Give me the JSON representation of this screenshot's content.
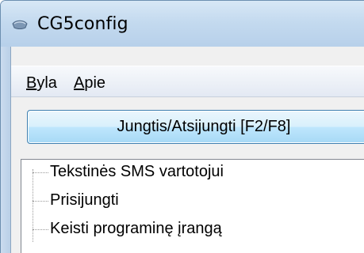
{
  "window": {
    "title": "CG5config"
  },
  "menu": {
    "items": [
      {
        "accel": "B",
        "rest": "yla"
      },
      {
        "accel": "A",
        "rest": "pie"
      }
    ]
  },
  "connect_button": {
    "label": "Jungtis/Atsijungti [F2/F8]"
  },
  "tree": {
    "items": [
      {
        "label": "Tekstinės SMS vartotojui"
      },
      {
        "label": "Prisijungti"
      },
      {
        "label": "Keisti programinę įrangą"
      }
    ]
  },
  "icons": {
    "app": "router-icon"
  },
  "colors": {
    "titlebar": "#c4daef",
    "button_border": "#3c7fb1",
    "button_fill": "#bee6fd",
    "client": "#f0f0f0"
  }
}
